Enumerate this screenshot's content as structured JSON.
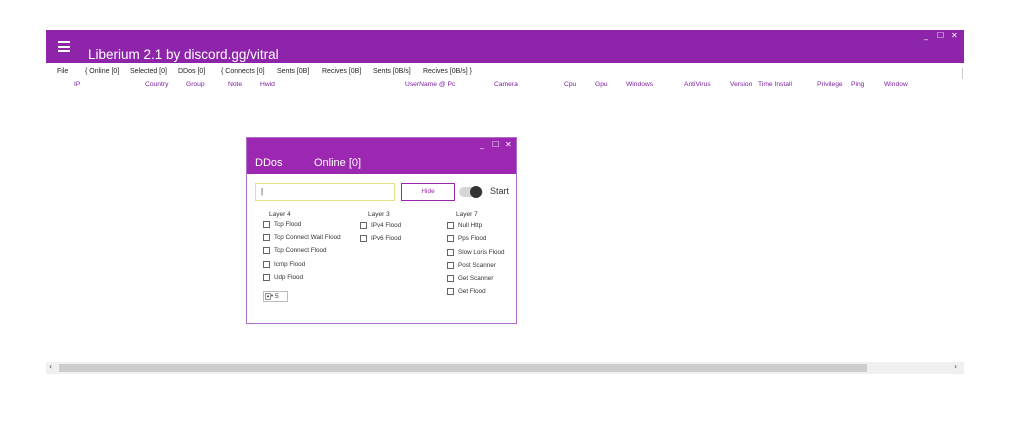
{
  "app": {
    "title": "Liberium 2.1 by discord.gg/vitral",
    "minimize": "_",
    "maximize": "☐",
    "close": "✕"
  },
  "menubar": {
    "file": "File",
    "online": "{ Online [0]",
    "selected": "Selected [0]",
    "ddos": "DDos [0]",
    "connects": "{ Connects [0]",
    "sents": "Sents [0B]",
    "recives": "Recives [0B]",
    "sents_rate": "Sents [0B/s]",
    "recives_rate": "Recives [0B/s] }"
  },
  "columns": {
    "ip": "IP",
    "country": "Country",
    "group": "Group",
    "note": "Note",
    "hwid": "Hwid",
    "username": "UserName @ Pc",
    "camera": "Camera",
    "cpu": "Cpu",
    "gpu": "Gpu",
    "windows": "Windows",
    "antivirus": "AntiVirus",
    "version": "Version",
    "time_install": "Time Install",
    "privilege": "Privilege",
    "ping": "Ping",
    "window": "Window"
  },
  "dialog": {
    "title": "DDos",
    "online": "Online [0]",
    "target_value": "|",
    "hide_label": "Hide",
    "start_label": "Start",
    "minimize": "_",
    "maximize": "☐",
    "close": "✕",
    "layer4": {
      "title": "Layer 4",
      "items": [
        "Tcp Flood",
        "Tcp Connect Wait Flood",
        "Tcp Connect Flood",
        "Icmp Flood",
        "Udp Flood"
      ]
    },
    "layer3": {
      "title": "Layer 3",
      "items": [
        "IPv4 Flood",
        "IPv6 Flood"
      ]
    },
    "layer7": {
      "title": "Layer 7",
      "items": [
        "Null Http",
        "Pps Flood",
        "Slow Loris Flood",
        "Post Scanner",
        "Get Scanner",
        "Get Flood"
      ]
    },
    "threads_value": "5",
    "stepper_arrows": "▲▼"
  },
  "scrollbar": {
    "left_arrow": "‹",
    "right_arrow": "›"
  },
  "colors": {
    "accent": "#8e24aa",
    "dialog_accent": "#9c27b0",
    "column_header": "#7b1fa2"
  }
}
